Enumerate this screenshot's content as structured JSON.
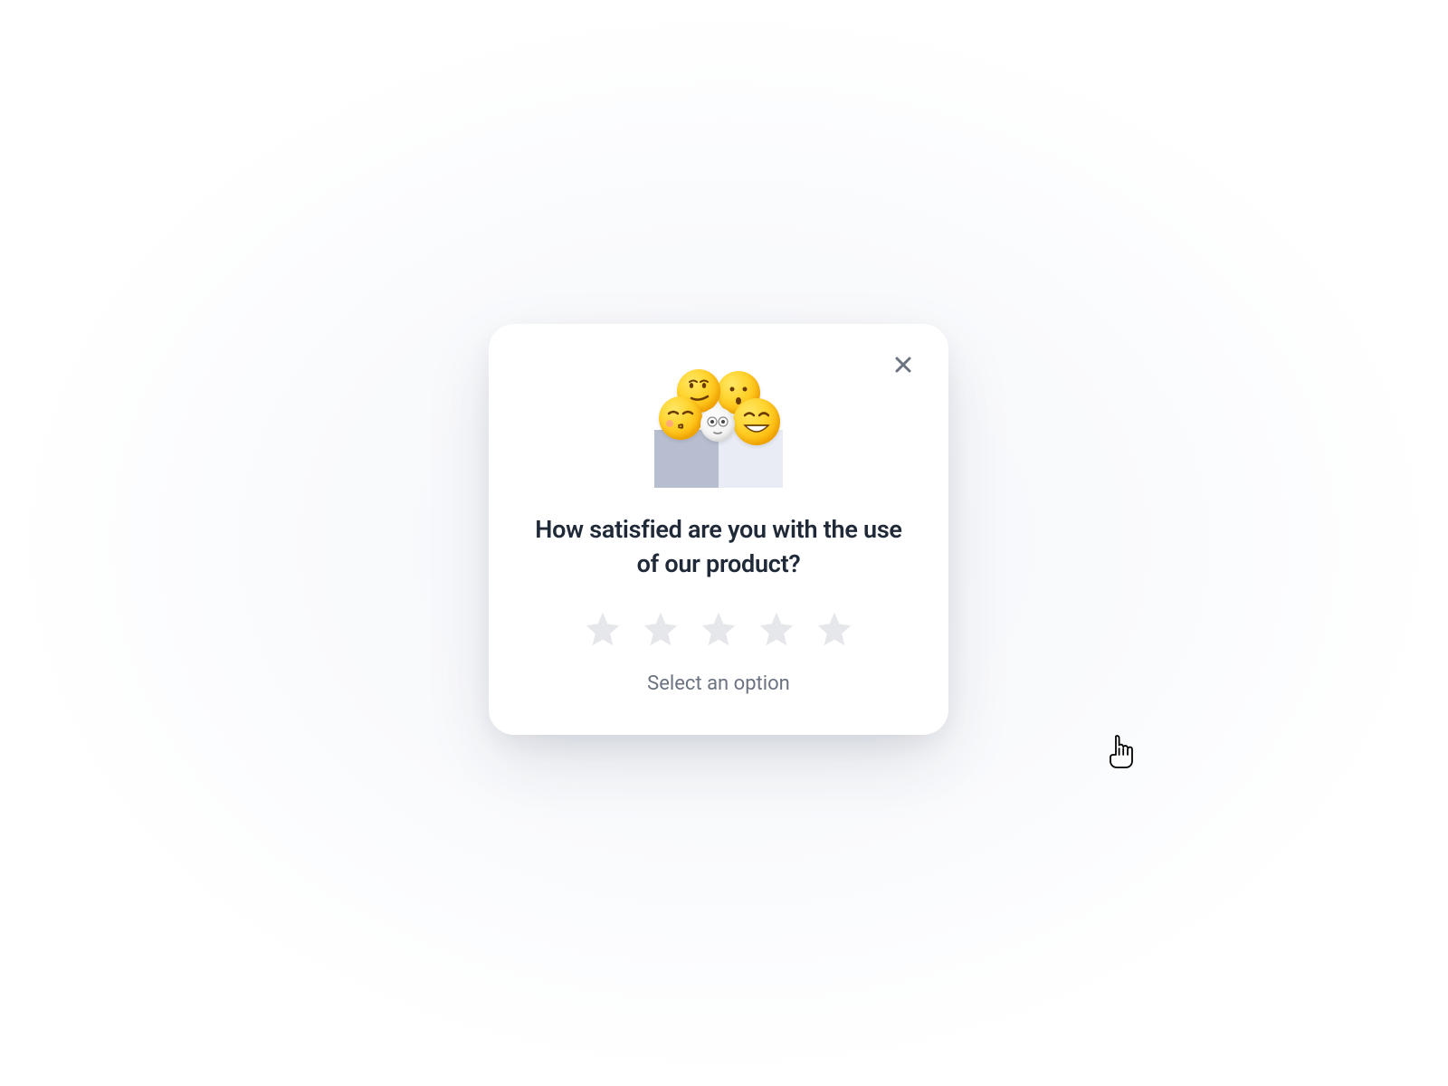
{
  "modal": {
    "question": "How satisfied are you with the use of our product?",
    "hint": "Select an option",
    "stars_count": 5,
    "selected_rating": 0
  },
  "icons": {
    "close": "close-icon",
    "star": "star-icon",
    "illustration": "emoji-box-illustration",
    "cursor": "pointer-cursor"
  },
  "colors": {
    "star_empty": "#e5e7eb",
    "text_primary": "#1f2937",
    "text_secondary": "#6b7280",
    "modal_bg": "#ffffff"
  }
}
